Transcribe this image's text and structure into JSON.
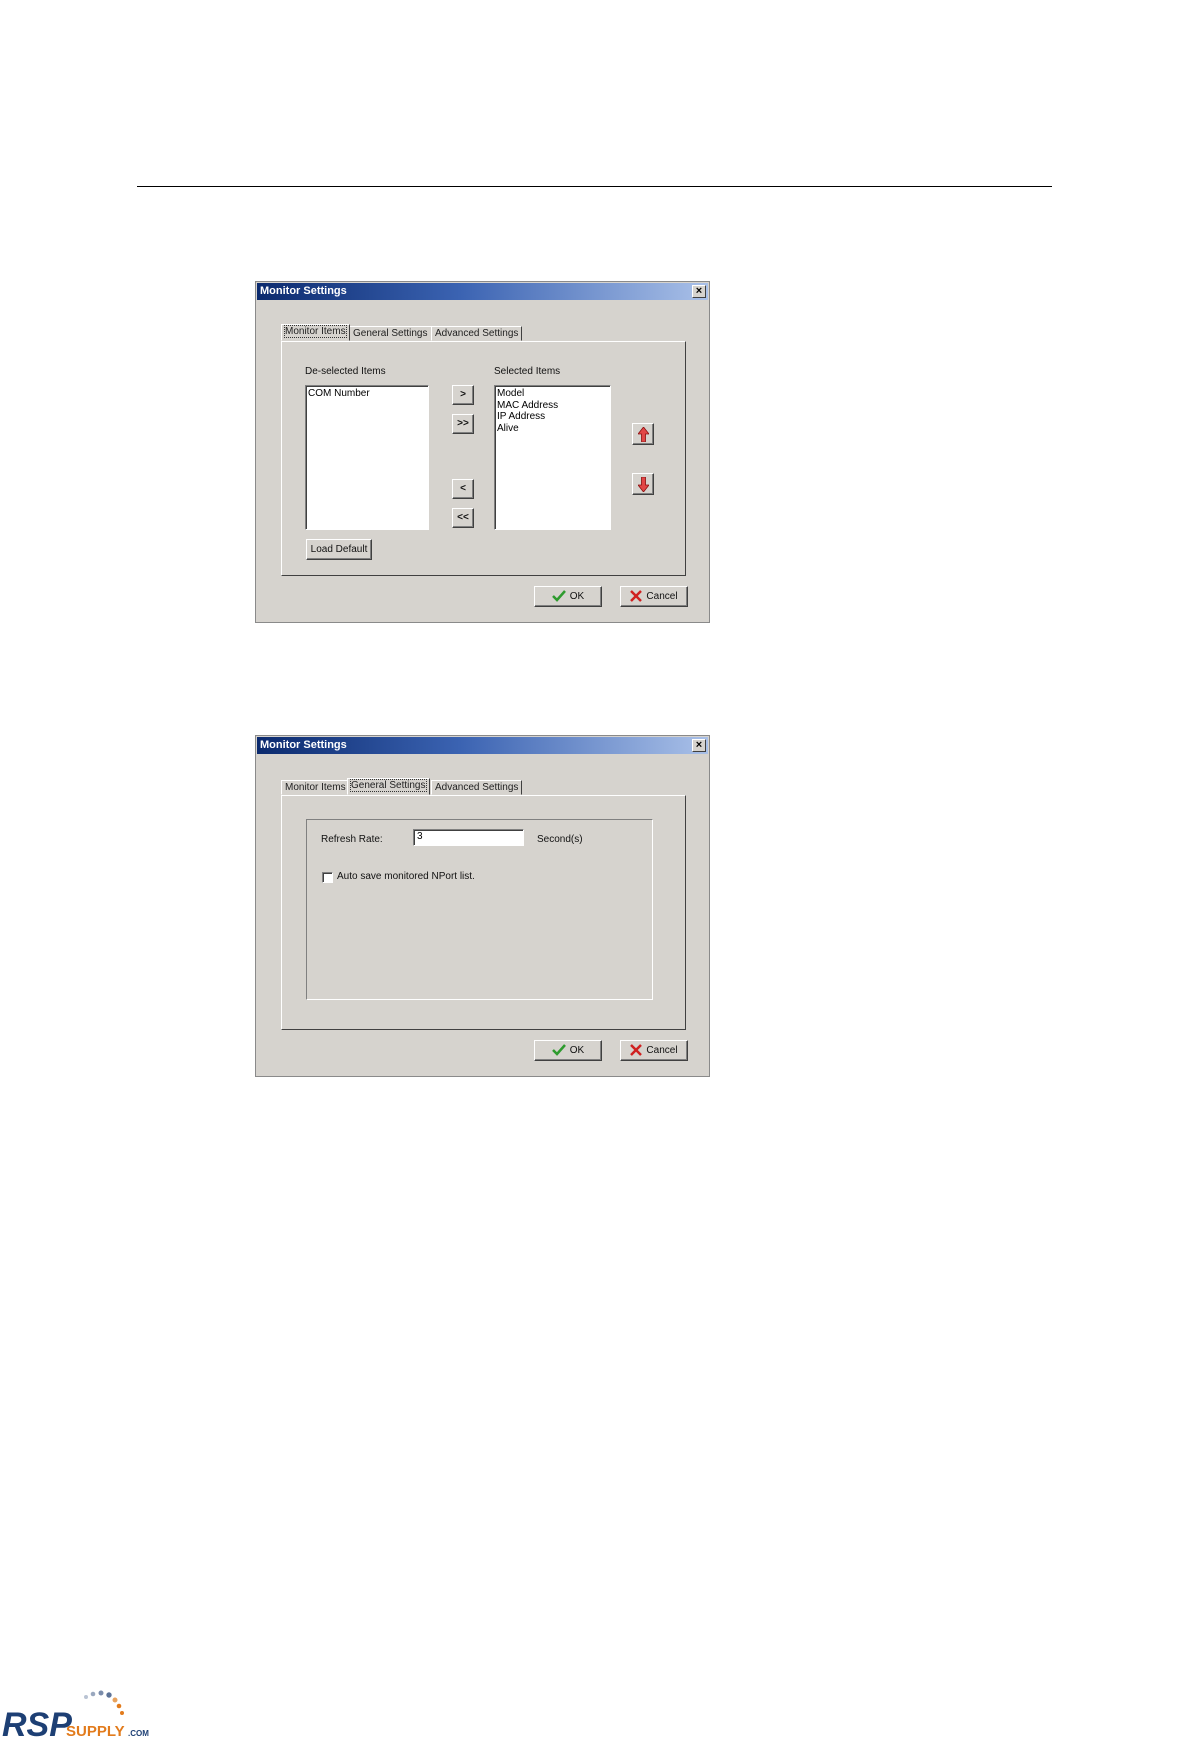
{
  "dialog1": {
    "title": "Monitor Settings",
    "close": "×",
    "tabs": [
      "Monitor Items",
      "General Settings",
      "Advanced Settings"
    ],
    "active_tab": "Monitor Items",
    "deselected_label": "De-selected Items",
    "selected_label": "Selected Items",
    "deselected_items": [
      "COM Number"
    ],
    "selected_items": [
      "Model",
      "MAC Address",
      "IP Address",
      "Alive"
    ],
    "move_right": ">",
    "move_all_right": ">>",
    "move_left": "<",
    "move_all_left": "<<",
    "load_default": "Load Default",
    "ok": "OK",
    "cancel": "Cancel"
  },
  "dialog2": {
    "title": "Monitor Settings",
    "close": "×",
    "tabs": [
      "Monitor Items",
      "General Settings",
      "Advanced Settings"
    ],
    "active_tab": "General Settings",
    "refresh_label": "Refresh Rate:",
    "refresh_value": "3",
    "refresh_unit": "Second(s)",
    "auto_save_label": "Auto save monitored NPort list.",
    "auto_save_checked": false,
    "ok": "OK",
    "cancel": "Cancel"
  },
  "logo": {
    "brand": "RSP",
    "supply": "SUPPLY",
    "suffix": ".COM"
  },
  "colors": {
    "dialog_bg": "#d6d3ce",
    "title_start": "#0b2a6e",
    "title_end": "#a9c0e8",
    "ok_green": "#2e9b2e",
    "cancel_red": "#d02020",
    "logo_navy": "#1d3f74",
    "logo_orange": "#e27b1c"
  }
}
